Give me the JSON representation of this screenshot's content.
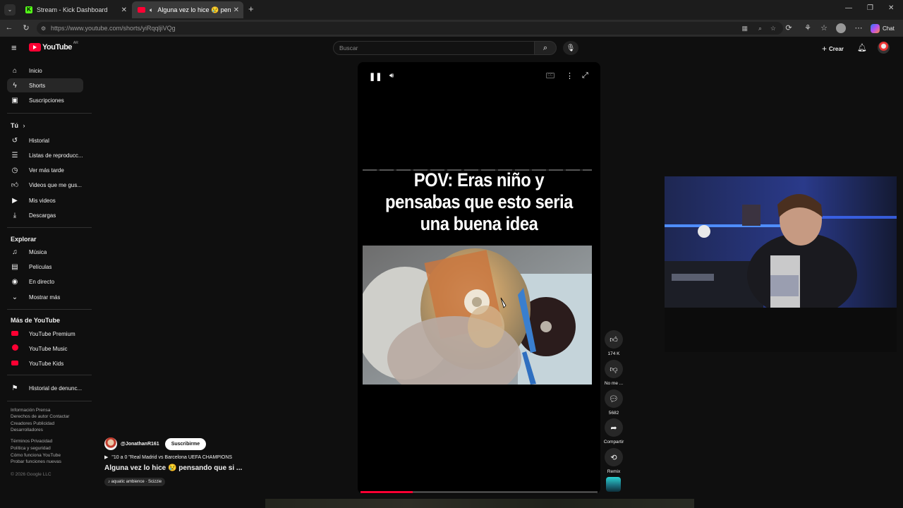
{
  "browser": {
    "tabs": [
      {
        "title": "Stream - Kick Dashboard",
        "active": false
      },
      {
        "title": "Alguna vez lo hice 😢 pensando",
        "active": true
      }
    ],
    "url_host": "https://www.youtube.com",
    "url_path": "/shorts/yiRqqljiVQg",
    "chat_label": "Chat"
  },
  "header": {
    "logo_text": "YouTube",
    "logo_region": "AR",
    "search_placeholder": "Buscar",
    "create_label": "Crear"
  },
  "sidebar": {
    "main": [
      {
        "label": "Inicio",
        "icon": "home-icon"
      },
      {
        "label": "Shorts",
        "icon": "shorts-icon",
        "selected": true
      },
      {
        "label": "Suscripciones",
        "icon": "subscriptions-icon"
      }
    ],
    "you_title": "Tú",
    "you": [
      {
        "label": "Historial",
        "icon": "history-icon"
      },
      {
        "label": "Listas de reproducc...",
        "icon": "playlist-icon"
      },
      {
        "label": "Ver más tarde",
        "icon": "clock-icon"
      },
      {
        "label": "Videos que me gus...",
        "icon": "like-icon"
      },
      {
        "label": "Mis videos",
        "icon": "video-icon"
      },
      {
        "label": "Descargas",
        "icon": "download-icon"
      }
    ],
    "explore_title": "Explorar",
    "explore": [
      {
        "label": "Música",
        "icon": "music-icon"
      },
      {
        "label": "Películas",
        "icon": "film-icon"
      },
      {
        "label": "En directo",
        "icon": "live-icon"
      },
      {
        "label": "Mostrar más",
        "icon": "chevron-down-icon"
      }
    ],
    "more_title": "Más de YouTube",
    "more": [
      {
        "label": "YouTube Premium",
        "icon": "youtube-premium-icon"
      },
      {
        "label": "YouTube Music",
        "icon": "youtube-music-icon"
      },
      {
        "label": "YouTube Kids",
        "icon": "youtube-kids-icon"
      }
    ],
    "report": {
      "label": "Historial de denunc...",
      "icon": "flag-icon"
    },
    "footer": {
      "line1": "Información  Prensa",
      "line2": "Derechos de autor  Contactar",
      "line3": "Creadores  Publicidad",
      "line4": "Desarrolladores",
      "line5": "Términos  Privacidad",
      "line6": "Política y seguridad",
      "line7": "Cómo funciona YouTube",
      "line8": "Probar funciones nuevas",
      "copyright": "© 2026 Google LLC"
    }
  },
  "short": {
    "caption_line1": "POV: Eras niño y",
    "caption_line2": "pensabas que esto seria",
    "caption_line3": "una buena idea",
    "channel": "@JonathanR161",
    "subscribe_label": "Suscribirme",
    "related": "\"10 a 0 \"Real Madrid vs Barcelona UEFA CHAMPIONS",
    "title": "Alguna vez lo hice 😢 pensando que si ...",
    "sound": "♪ aquatic ambience · Scizzie",
    "progress": 0.22
  },
  "actions": {
    "likes": "174 K",
    "dislike": "No me ...",
    "comments": "5682",
    "share": "Compartir",
    "remix": "Remix"
  }
}
